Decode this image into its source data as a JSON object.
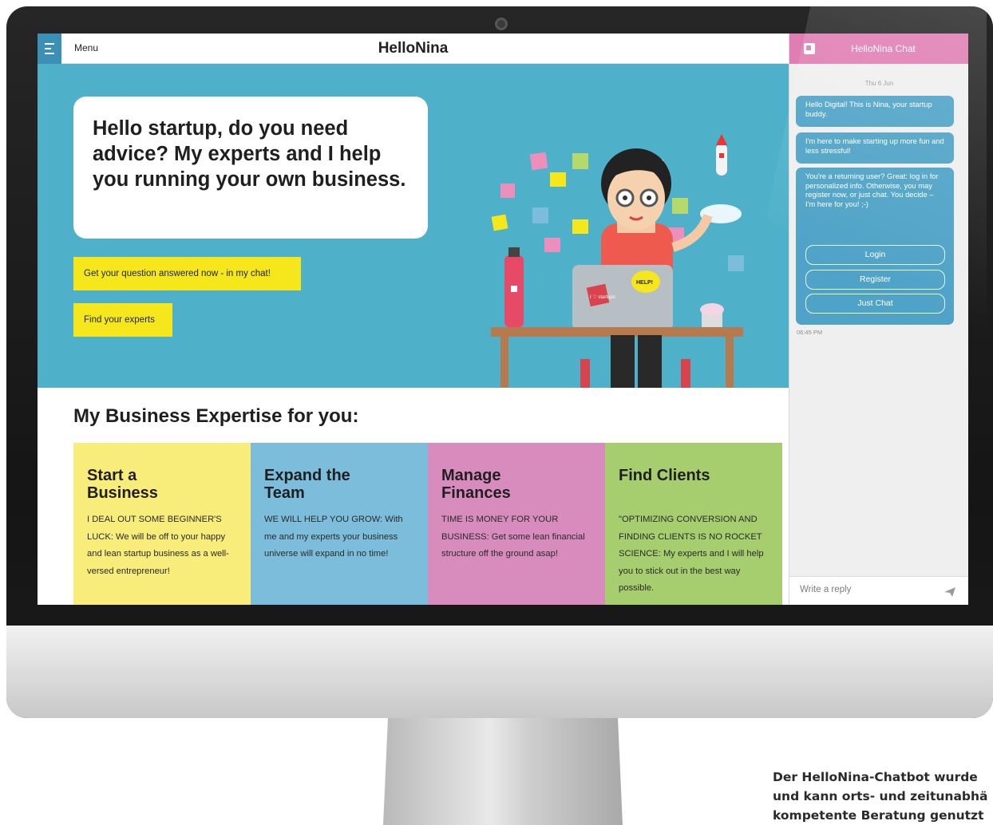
{
  "topbar": {
    "menu_label": "Menu",
    "brand": "HelloNina"
  },
  "hero": {
    "headline": "Hello startup, do you need advice? My experts and I help you running your own business.",
    "cta_primary": "Get your question answered now - in my chat!",
    "cta_secondary": "Find your experts"
  },
  "expertise": {
    "heading": "My Business Expertise for you:",
    "cards": [
      {
        "title": "Start a\nBusiness",
        "text": "I DEAL OUT SOME BEGINNER'S LUCK: We will be off to your happy and lean startup business as a well-versed entrepreneur!"
      },
      {
        "title": "Expand the\nTeam",
        "text": "WE WILL HELP YOU GROW: With me and my experts your business universe will expand in no time!"
      },
      {
        "title": "Manage\nFinances",
        "text": "TIME IS MONEY FOR YOUR BUSINESS: Get some lean financial structure off the ground asap!"
      },
      {
        "title": "Find Clients",
        "text": "\"OPTIMIZING CONVERSION AND FINDING CLIENTS IS NO ROCKET SCIENCE:  My experts and I will help you to stick out in the best way possible."
      }
    ]
  },
  "chat": {
    "title": "HelloNina Chat",
    "date": "Thu 6 Jun",
    "messages": [
      "Hello Digital! This is Nina, your startup buddy.",
      "I'm here to make starting up more fun and less stressful!",
      "You're a returning user? Great: log in for personalized info. Otherwise, you may register now, or just chat. You decide – I'm here for you! ;-)"
    ],
    "buttons": {
      "login": "Login",
      "register": "Register",
      "just_chat": "Just Chat"
    },
    "time": "06:45 PM",
    "reply_placeholder": "Write a reply"
  },
  "illustration": {
    "sticker_love": "I ♡ startups",
    "sticker_help": "HELP!"
  },
  "caption": {
    "line1": "Der HelloNina-Chatbot wurde",
    "line2": "und kann orts- und zeitunabhä",
    "line3": "kompetente Beratung genutzt"
  },
  "colors": {
    "hero_bg": "#4eb1c9",
    "cta_yellow": "#f6e71d",
    "card_yellow": "#f8ec7a",
    "card_blue": "#7dbddc",
    "card_pink": "#d78cbd",
    "card_green": "#a7ce6e",
    "chat_header": "#e07db3",
    "chat_bubble": "#4fa3c7"
  }
}
